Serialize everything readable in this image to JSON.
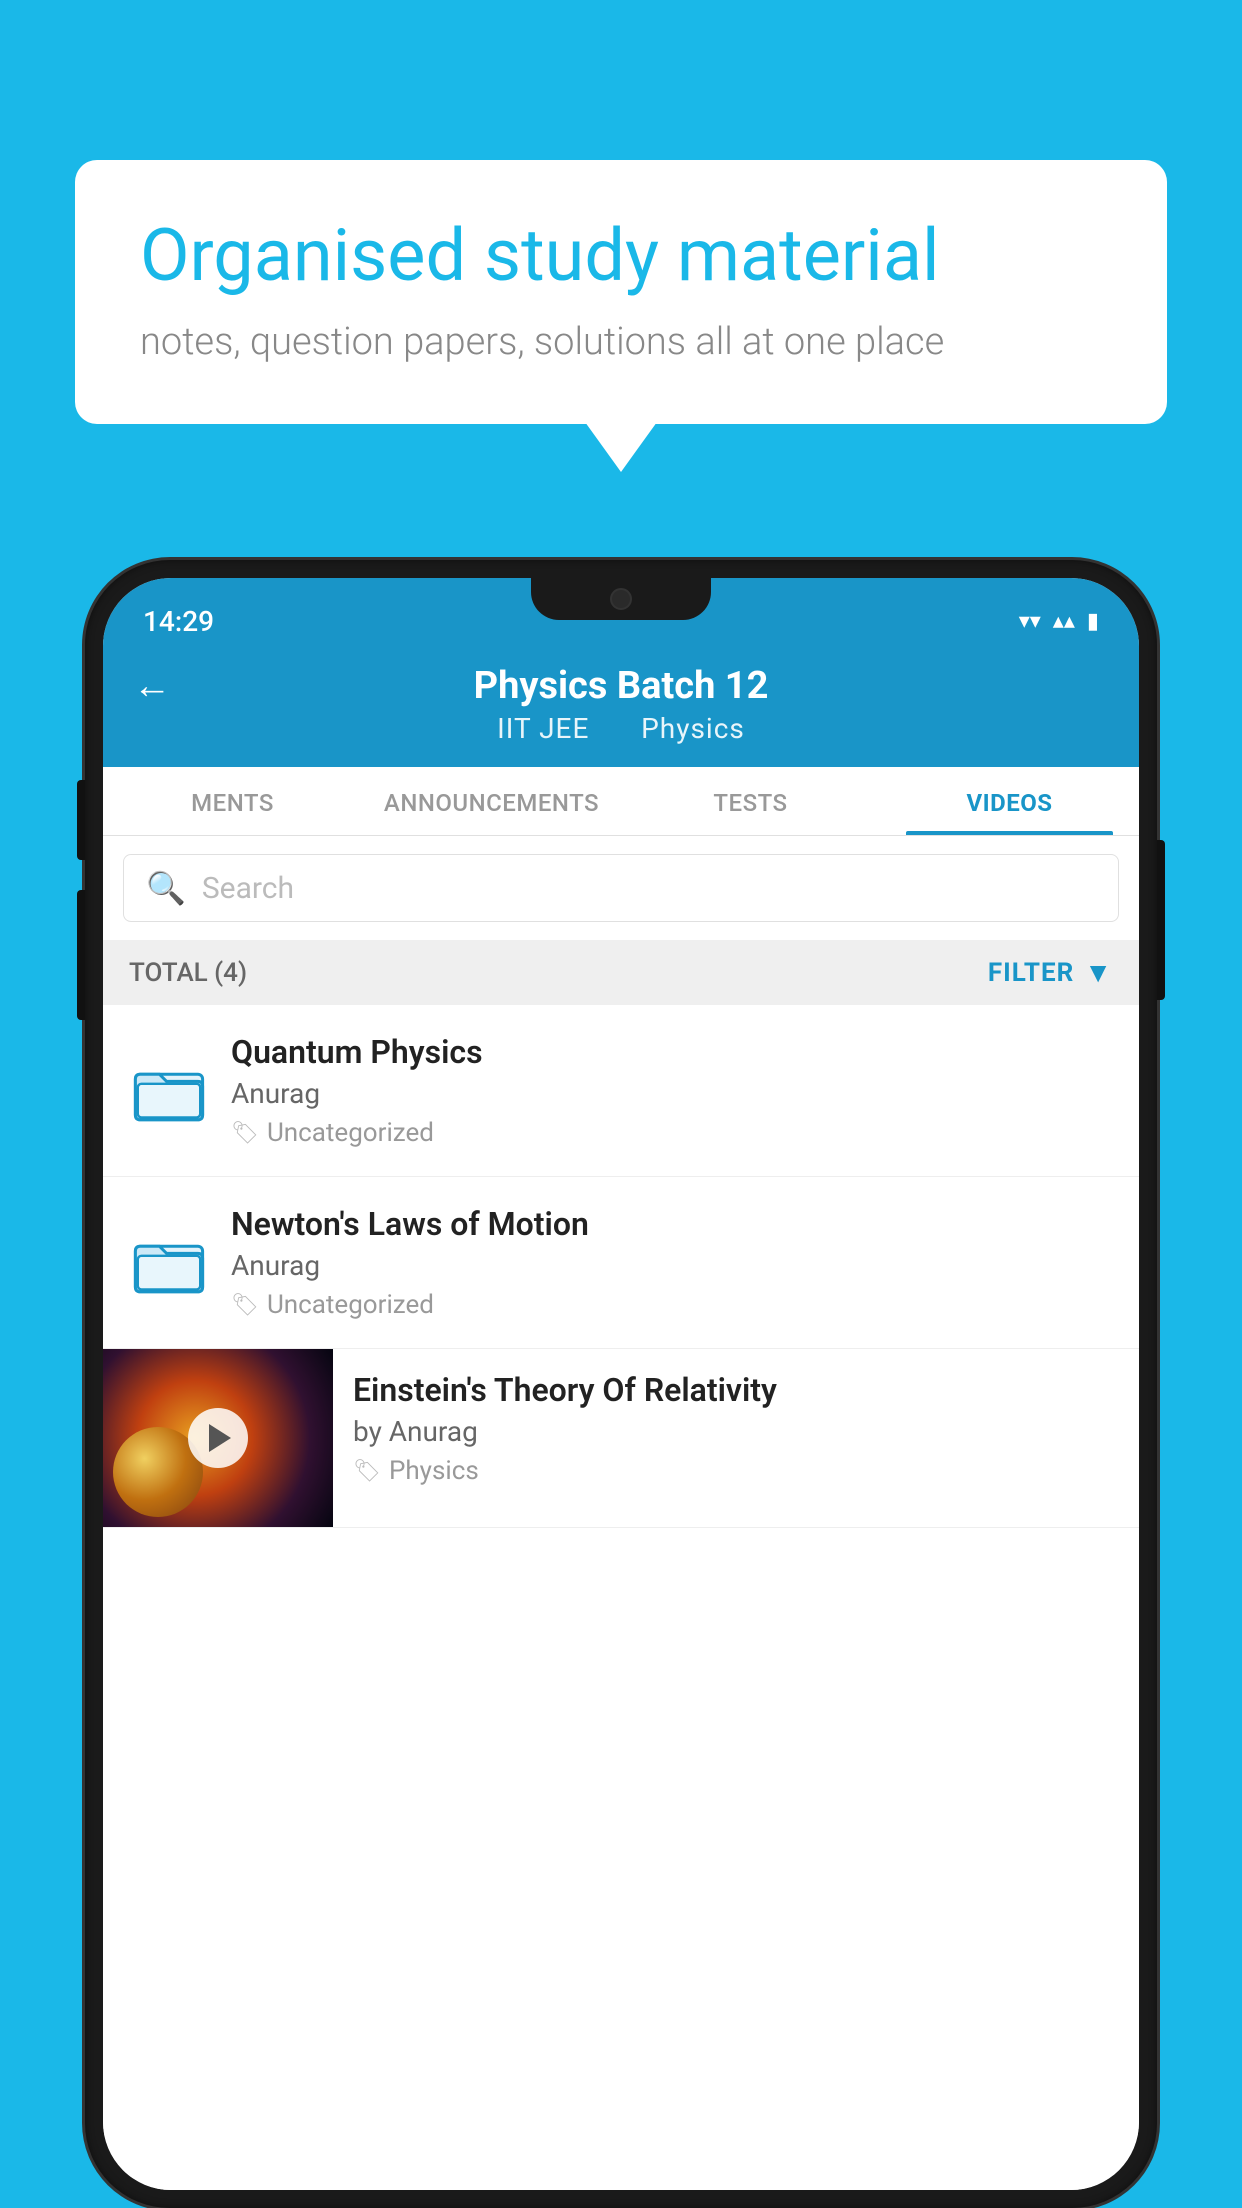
{
  "background_color": "#1ab8e8",
  "speech_bubble": {
    "heading": "Organised study material",
    "subtext": "notes, question papers, solutions all at one place"
  },
  "status_bar": {
    "time": "14:29",
    "wifi": "▾",
    "signal": "▴▴",
    "battery": "▮"
  },
  "app_header": {
    "back_label": "←",
    "title": "Physics Batch 12",
    "subtitle_part1": "IIT JEE",
    "subtitle_part2": "Physics"
  },
  "tabs": [
    {
      "label": "MENTS",
      "active": false
    },
    {
      "label": "ANNOUNCEMENTS",
      "active": false
    },
    {
      "label": "TESTS",
      "active": false
    },
    {
      "label": "VIDEOS",
      "active": true
    }
  ],
  "search": {
    "placeholder": "Search"
  },
  "filter_bar": {
    "total_label": "TOTAL (4)",
    "filter_label": "FILTER"
  },
  "videos": [
    {
      "title": "Quantum Physics",
      "author": "Anurag",
      "tag": "Uncategorized",
      "has_thumb": false
    },
    {
      "title": "Newton's Laws of Motion",
      "author": "Anurag",
      "tag": "Uncategorized",
      "has_thumb": false
    },
    {
      "title": "Einstein's Theory Of Relativity",
      "author": "by Anurag",
      "tag": "Physics",
      "has_thumb": true
    }
  ]
}
